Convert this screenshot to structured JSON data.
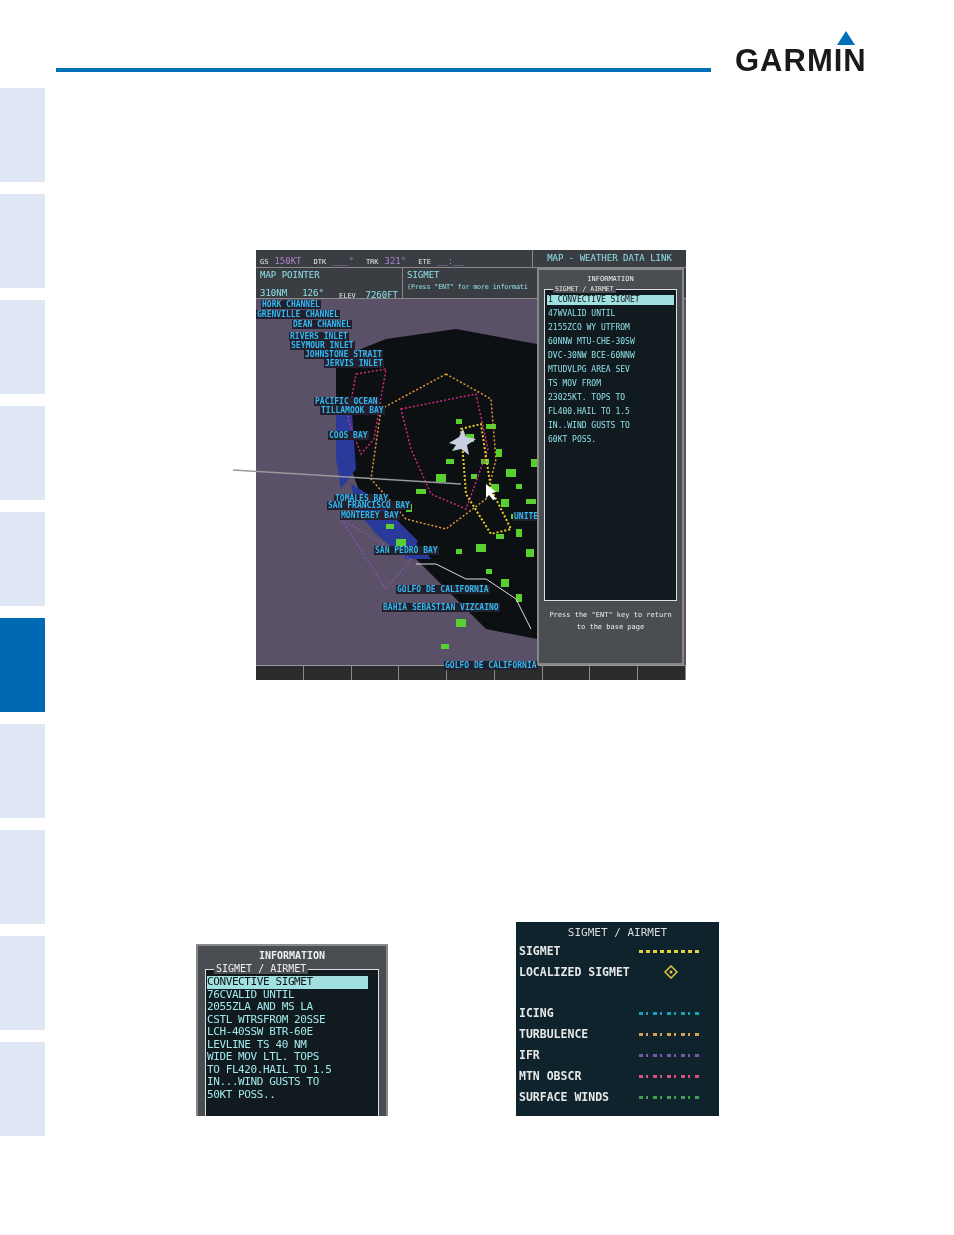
{
  "header": {
    "logo": "GARMIN"
  },
  "side_tabs": [
    {
      "selected": false
    },
    {
      "selected": false
    },
    {
      "selected": false
    },
    {
      "selected": false
    },
    {
      "selected": false
    },
    {
      "selected": true
    },
    {
      "selected": false
    },
    {
      "selected": false
    },
    {
      "selected": false
    },
    {
      "selected": false
    }
  ],
  "display": {
    "top_bar": {
      "fields": [
        {
          "label": "GS",
          "value": "150KT"
        },
        {
          "label": "DTK",
          "value": "___°"
        },
        {
          "label": "TRK",
          "value": "321°"
        },
        {
          "label": "ETE",
          "value": "__:__"
        }
      ],
      "page_title": "MAP - WEATHER DATA LINK"
    },
    "pointer": {
      "title": "MAP POINTER",
      "distance": "310NM",
      "bearing": "126°",
      "elev_label": "ELEV",
      "elev_value": "7260FT"
    },
    "sigmet": {
      "title": "SIGMET",
      "hint": "(Press \"ENT\" for more informati"
    },
    "map": {
      "labels": [
        "HORK CHANNEL",
        "GRENVILLE CHANNEL",
        "DEAN CHANNEL",
        "RIVERS INLET",
        "SEYMOUR INLET",
        "JOHNSTONE STRAIT",
        "JERVIS INLET",
        "PACIFIC OCEAN",
        "TILLAMOOK BAY",
        "COOS BAY",
        "TOMALES BAY",
        "SAN FRANCISCO BAY",
        "MONTEREY BAY",
        "UNITE",
        "SAN PEDRO BAY",
        "GOLFO DE CALIFORNIA",
        "BAHIA SEBASTIAN VIZCAINO",
        "GOLFO DE CALIFORNIA"
      ]
    },
    "info_panel": {
      "title": "INFORMATION",
      "tab": "SIGMET / AIRMET",
      "lines": [
        {
          "text": "1 CONVECTIVE SIGMET",
          "selected": true
        },
        {
          "text": "47WVALID UNTIL",
          "selected": false
        },
        {
          "text": "2155ZCO WY UTFROM",
          "selected": false
        },
        {
          "text": "60NNW MTU-CHE-30SW",
          "selected": false
        },
        {
          "text": "DVC-30NW BCE-60NNW",
          "selected": false
        },
        {
          "text": "MTUDVLPG AREA SEV",
          "selected": false
        },
        {
          "text": "TS MOV FROM",
          "selected": false
        },
        {
          "text": "23025KT. TOPS TO",
          "selected": false
        },
        {
          "text": "FL400.HAIL TO 1.5",
          "selected": false
        },
        {
          "text": "IN..WIND GUSTS TO",
          "selected": false
        },
        {
          "text": "60KT POSS.",
          "selected": false
        }
      ],
      "footer": [
        "Press the \"ENT\" key to return",
        "to the base page"
      ]
    }
  },
  "inset_info": {
    "title": "INFORMATION",
    "tab": "SIGMET / AIRMET",
    "lines": [
      {
        "text": "CONVECTIVE SIGMET",
        "selected": true
      },
      {
        "text": "76CVALID UNTIL",
        "selected": false
      },
      {
        "text": "2055ZLA AND MS LA",
        "selected": false
      },
      {
        "text": "CSTL WTRSFROM 20SSE",
        "selected": false
      },
      {
        "text": "LCH-40SSW BTR-60E",
        "selected": false
      },
      {
        "text": "LEVLINE TS 40 NM",
        "selected": false
      },
      {
        "text": "WIDE MOV LTL. TOPS",
        "selected": false
      },
      {
        "text": "TO FL420.HAIL TO 1.5",
        "selected": false
      },
      {
        "text": "IN...WIND GUSTS TO",
        "selected": false
      },
      {
        "text": "50KT POSS..",
        "selected": false
      }
    ]
  },
  "legend": {
    "title": "SIGMET / AIRMET",
    "groups": [
      [
        {
          "label": "SIGMET",
          "kind": "dashed",
          "color": "#e6d23c"
        },
        {
          "label": "LOCALIZED SIGMET",
          "kind": "diamond",
          "color": "#e6c640"
        }
      ],
      [
        {
          "label": "ICING",
          "kind": "dotted",
          "color": "#1aa0b8"
        },
        {
          "label": "TURBULENCE",
          "kind": "dotted",
          "color": "#d8a050"
        },
        {
          "label": "IFR",
          "kind": "dotted",
          "color": "#7a58a8"
        },
        {
          "label": "MTN OBSCR",
          "kind": "dotted",
          "color": "#d8508a"
        },
        {
          "label": "SURFACE WINDS",
          "kind": "dotted",
          "color": "#40a050"
        }
      ]
    ]
  }
}
